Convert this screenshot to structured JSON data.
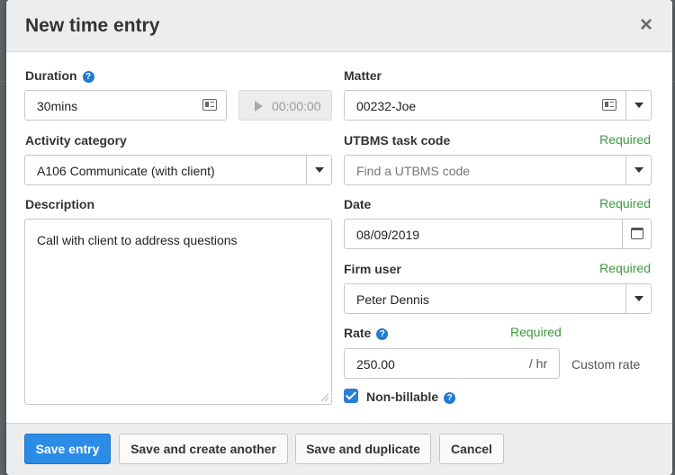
{
  "modal": {
    "title": "New time entry"
  },
  "form": {
    "duration": {
      "label": "Duration",
      "value": "30mins"
    },
    "timer": {
      "value": "00:00:00"
    },
    "matter": {
      "label": "Matter",
      "value": "00232-Joe"
    },
    "activity_category": {
      "label": "Activity category",
      "value": "A106 Communicate (with client)"
    },
    "utbms": {
      "label": "UTBMS task code",
      "required": "Required",
      "placeholder": "Find a UTBMS code"
    },
    "description": {
      "label": "Description",
      "value": "Call with client to address questions"
    },
    "date": {
      "label": "Date",
      "required": "Required",
      "value": "08/09/2019"
    },
    "firm_user": {
      "label": "Firm user",
      "required": "Required",
      "value": "Peter Dennis"
    },
    "rate": {
      "label": "Rate",
      "required": "Required",
      "value": "250.00",
      "suffix": "/ hr",
      "custom_label": "Custom rate"
    },
    "non_billable": {
      "label": "Non-billable",
      "checked": true
    }
  },
  "footer": {
    "save_entry": "Save entry",
    "save_and_create_another": "Save and create another",
    "save_and_duplicate": "Save and duplicate",
    "cancel": "Cancel"
  },
  "icons": {
    "close": "close-icon",
    "help": "help-icon",
    "contact_card": "contact-card-icon",
    "play": "play-icon",
    "calendar": "calendar-icon",
    "caret": "chevron-down-icon",
    "check": "check-icon"
  },
  "colors": {
    "primary": "#2a8ce6",
    "required": "#3c9a3c",
    "help": "#1f7bd1",
    "checkbox": "#2a7fd6"
  }
}
